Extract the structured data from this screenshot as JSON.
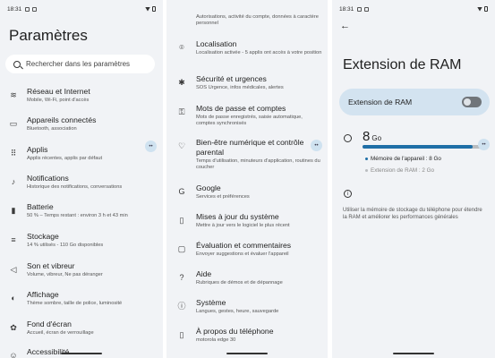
{
  "status": {
    "time": "18:31"
  },
  "left": {
    "title": "Paramètres",
    "search_placeholder": "Rechercher dans les paramètres",
    "items": [
      {
        "icon": "wifi-icon",
        "glyph": "≋",
        "title": "Réseau et Internet",
        "subtitle": "Mobile, Wi-Fi, point d'accès"
      },
      {
        "icon": "devices-icon",
        "glyph": "▭",
        "title": "Appareils connectés",
        "subtitle": "Bluetooth, association"
      },
      {
        "icon": "apps-icon",
        "glyph": "⠿",
        "title": "Applis",
        "subtitle": "Applis récentes, applis par défaut"
      },
      {
        "icon": "bell-icon",
        "glyph": "♪",
        "title": "Notifications",
        "subtitle": "Historique des notifications, conversations"
      },
      {
        "icon": "battery-icon",
        "glyph": "▮",
        "title": "Batterie",
        "subtitle": "50 % – Temps restant : environ 3 h et 43 min"
      },
      {
        "icon": "storage-icon",
        "glyph": "≡",
        "title": "Stockage",
        "subtitle": "14 % utilisés - 110 Go disponibles"
      },
      {
        "icon": "volume-icon",
        "glyph": "◁",
        "title": "Son et vibreur",
        "subtitle": "Volume, vibreur, Ne pas déranger"
      },
      {
        "icon": "display-icon",
        "glyph": "◐",
        "title": "Affichage",
        "subtitle": "Thème sombre, taille de police, luminosité"
      },
      {
        "icon": "wallpaper-icon",
        "glyph": "✿",
        "title": "Fond d'écran",
        "subtitle": "Accueil, écran de verrouillage"
      },
      {
        "icon": "accessibility-icon",
        "glyph": "☺",
        "title": "Accessibilité",
        "subtitle": ""
      }
    ]
  },
  "middle": {
    "top_partial": "Autorisations, activité du compte, données à caractère personnel",
    "items": [
      {
        "icon": "location-icon",
        "glyph": "⌾",
        "title": "Localisation",
        "subtitle": "Localisation activée - 5 applis ont accès à votre position"
      },
      {
        "icon": "emergency-icon",
        "glyph": "✱",
        "title": "Sécurité et urgences",
        "subtitle": "SOS Urgence, infos médicales, alertes"
      },
      {
        "icon": "key-icon",
        "glyph": "⚿",
        "title": "Mots de passe et comptes",
        "subtitle": "Mots de passe enregistrés, saisie automatique, comptes synchronisés"
      },
      {
        "icon": "wellbeing-icon",
        "glyph": "♡",
        "title": "Bien-être numérique et contrôle parental",
        "subtitle": "Temps d'utilisation, minuteurs d'application, routines du coucher"
      },
      {
        "icon": "google-icon",
        "glyph": "G",
        "title": "Google",
        "subtitle": "Services et préférences"
      },
      {
        "icon": "system-update-icon",
        "glyph": "▯",
        "title": "Mises à jour du système",
        "subtitle": "Mettre à jour vers le logiciel le plus récent"
      },
      {
        "icon": "feedback-icon",
        "glyph": "▢",
        "title": "Évaluation et commentaires",
        "subtitle": "Envoyer suggestions et évaluer l'appareil"
      },
      {
        "icon": "help-icon",
        "glyph": "?",
        "title": "Aide",
        "subtitle": "Rubriques de démos et de dépannage"
      },
      {
        "icon": "system-icon",
        "glyph": "ⓘ",
        "title": "Système",
        "subtitle": "Langues, gestes, heure, sauvegarde"
      },
      {
        "icon": "phone-info-icon",
        "glyph": "▯",
        "title": "À propos du téléphone",
        "subtitle": "motorola edge 30"
      }
    ]
  },
  "right": {
    "title": "Extension de RAM",
    "toggle_label": "Extension de RAM",
    "toggle_on": false,
    "memory_value": "8",
    "memory_unit": "Go",
    "device_fraction": 0.88,
    "legend_device": "Mémoire de l'appareil : 8 Go",
    "legend_extension": "Extension de RAM : 2 Go",
    "info_text": "Utiliser la mémoire de stockage du téléphone pour étendre la RAM et améliorer les performances générales",
    "colors": {
      "device": "#1f6fa7",
      "extension": "#b9bcbf"
    }
  }
}
